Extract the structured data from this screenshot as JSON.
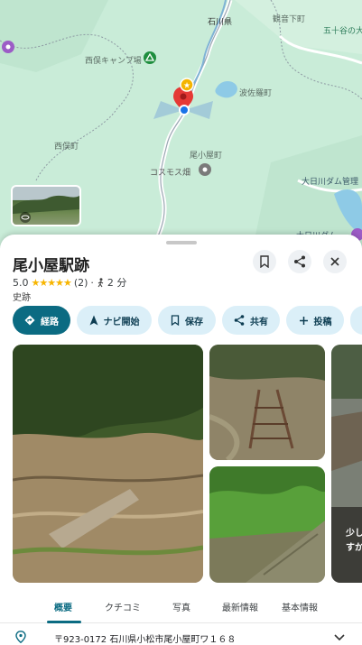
{
  "map": {
    "labels": {
      "ishikawa": "石川県",
      "kannonshita": "観音下町",
      "isogatani": "五十谷の大",
      "nishimata_camp": "西俣キャンプ場",
      "hasa_lake": "波佐羅町",
      "nishimata_town": "西俣町",
      "obiya_town": "尾小屋町",
      "cosmos": "コスモス畑",
      "dam": "大日川ダム管理",
      "partial": "大日川ダム"
    },
    "colors": {
      "land": "#c9ecd8",
      "road": "#ffffff",
      "river": "#7fb3d5",
      "pin": "#e53935"
    }
  },
  "place": {
    "title": "尾小屋駅跡",
    "rating": "5.0",
    "stars": "★★★★★",
    "review_count": "(2)",
    "separator": "·",
    "walk_time": "2 分",
    "category": "史跡"
  },
  "actions": {
    "directions": "経路",
    "start": "ナビ開始",
    "save": "保存",
    "share": "共有",
    "post": "投稿"
  },
  "photo_overlay": {
    "line1": "少し",
    "line2": "すか"
  },
  "tabs": [
    "概要",
    "クチコミ",
    "写真",
    "最新情報",
    "基本情報"
  ],
  "address": {
    "text": "〒923-0172 石川県小松市尾小屋町ワ１６８"
  }
}
